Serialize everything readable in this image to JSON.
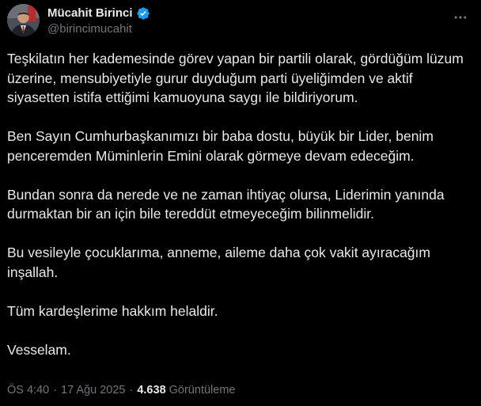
{
  "author": {
    "name": "Mücahit Birinci",
    "handle": "@birincimucahit",
    "verified": true
  },
  "tweet": {
    "paragraphs": [
      "Teşkilatın her kademesinde görev yapan bir partili olarak, gördüğüm lüzum üzerine, mensubiyetiyle gurur duyduğum parti üyeliğimden ve aktif siyasetten istifa ettiğimi kamuoyuna saygı ile bildiriyorum.",
      "Ben Sayın Cumhurbaşkanımızı bir baba dostu, büyük bir Lider, benim penceremden Müminlerin Emini olarak görmeye devam edeceğim.",
      "Bundan sonra da nerede ve ne zaman ihtiyaç olursa, Liderimin yanında durmaktan bir an için bile tereddüt etmeyeceğim bilinmelidir.",
      "Bu vesileyle çocuklarıma, anneme, aileme daha çok vakit ayıracağım inşallah.",
      "Tüm kardeşlerime hakkım helaldir.",
      "Vesselam."
    ]
  },
  "meta": {
    "time": "ÖS 4:40",
    "separator": "·",
    "date": "17 Ağu 2025",
    "views_count": "4.638",
    "views_label": "Görüntüleme"
  },
  "colors": {
    "background": "#000000",
    "text": "#e7e9ea",
    "muted": "#71767b",
    "verified": "#1d9bf0"
  },
  "icons": {
    "verified": "verified-badge-icon",
    "more": "more-options-icon"
  }
}
